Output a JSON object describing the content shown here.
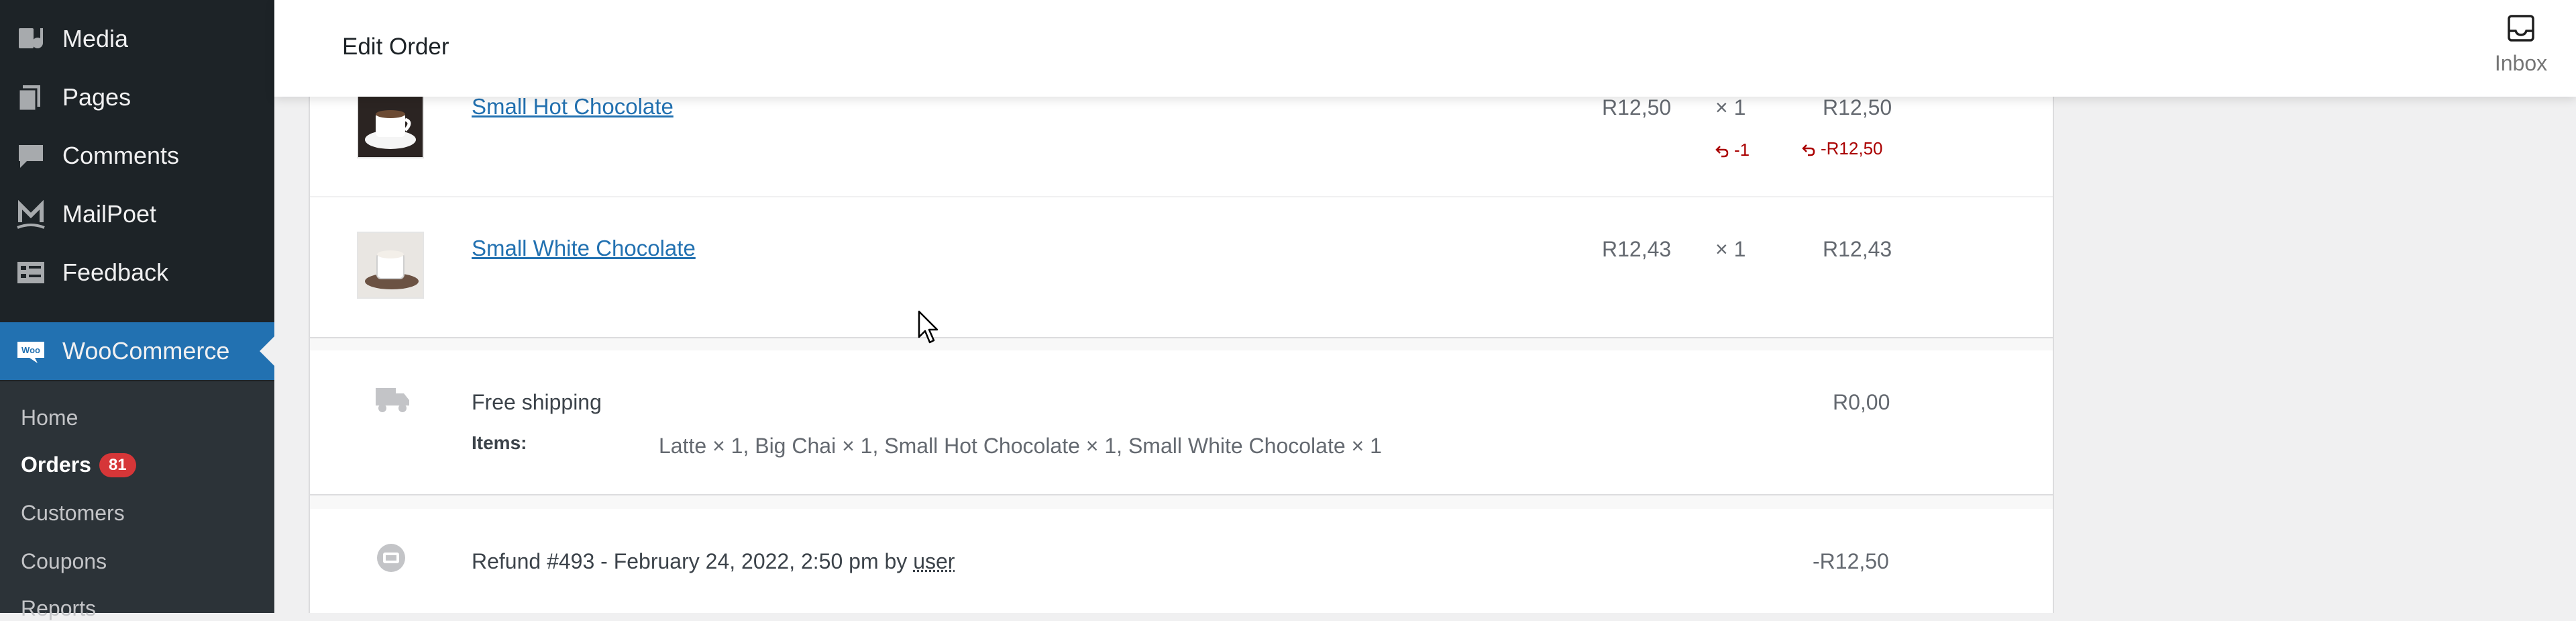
{
  "sidebar": {
    "items": [
      {
        "label": "Media",
        "icon": "media-icon"
      },
      {
        "label": "Pages",
        "icon": "pages-icon"
      },
      {
        "label": "Comments",
        "icon": "comments-icon"
      },
      {
        "label": "MailPoet",
        "icon": "mailpoet-icon"
      },
      {
        "label": "Feedback",
        "icon": "feedback-icon"
      },
      {
        "label": "WooCommerce",
        "icon": "woocommerce-icon",
        "active": true
      }
    ],
    "submenu": [
      {
        "label": "Home"
      },
      {
        "label": "Orders",
        "badge": "81",
        "current": true
      },
      {
        "label": "Customers"
      },
      {
        "label": "Coupons"
      },
      {
        "label": "Reports"
      }
    ]
  },
  "header": {
    "title": "Edit Order",
    "inbox_label": "Inbox"
  },
  "order_items": [
    {
      "name": "Small Hot Chocolate",
      "cost": "R12,50",
      "qty": "× 1",
      "total": "R12,50",
      "refund_qty": "-1",
      "refund_total": "-R12,50"
    },
    {
      "name": "Small White Chocolate",
      "cost": "R12,43",
      "qty": "× 1",
      "total": "R12,43"
    }
  ],
  "shipping": {
    "method": "Free shipping",
    "items_label": "Items:",
    "items_value": "Latte × 1, Big Chai × 1, Small Hot Chocolate × 1, Small White Chocolate × 1",
    "total": "R0,00"
  },
  "refund": {
    "prefix": "Refund #493 - February 24, 2022, 2:50 pm by",
    "user": "user",
    "total": "-R12,50"
  },
  "colors": {
    "sidebar_bg": "#1d2327",
    "active_bg": "#2271b1",
    "badge_bg": "#d63638",
    "link": "#2271b1",
    "refund": "#aa0000"
  }
}
